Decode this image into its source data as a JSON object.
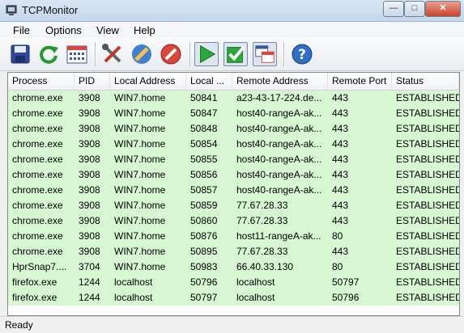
{
  "window": {
    "title": "TCPMonitor"
  },
  "menu": {
    "items": [
      "File",
      "Options",
      "View",
      "Help"
    ]
  },
  "toolbar": {
    "buttons": [
      "save-icon",
      "refresh-icon",
      "calendar-icon",
      "tools-icon",
      "edit-icon",
      "stop-icon",
      "play-icon",
      "checkbox-icon",
      "window-icon",
      "help-icon"
    ]
  },
  "table": {
    "columns": [
      "Process",
      "PID",
      "Local Address",
      "Local ...",
      "Remote Address",
      "Remote Port",
      "Status"
    ],
    "rows": [
      [
        "chrome.exe",
        "3908",
        "WIN7.home",
        "50841",
        "a23-43-17-224.de...",
        "443",
        "ESTABLISHED"
      ],
      [
        "chrome.exe",
        "3908",
        "WIN7.home",
        "50847",
        "host40-rangeA-ak...",
        "443",
        "ESTABLISHED"
      ],
      [
        "chrome.exe",
        "3908",
        "WIN7.home",
        "50848",
        "host40-rangeA-ak...",
        "443",
        "ESTABLISHED"
      ],
      [
        "chrome.exe",
        "3908",
        "WIN7.home",
        "50854",
        "host40-rangeA-ak...",
        "443",
        "ESTABLISHED"
      ],
      [
        "chrome.exe",
        "3908",
        "WIN7.home",
        "50855",
        "host40-rangeA-ak...",
        "443",
        "ESTABLISHED"
      ],
      [
        "chrome.exe",
        "3908",
        "WIN7.home",
        "50856",
        "host40-rangeA-ak...",
        "443",
        "ESTABLISHED"
      ],
      [
        "chrome.exe",
        "3908",
        "WIN7.home",
        "50857",
        "host40-rangeA-ak...",
        "443",
        "ESTABLISHED"
      ],
      [
        "chrome.exe",
        "3908",
        "WIN7.home",
        "50859",
        "77.67.28.33",
        "443",
        "ESTABLISHED"
      ],
      [
        "chrome.exe",
        "3908",
        "WIN7.home",
        "50860",
        "77.67.28.33",
        "443",
        "ESTABLISHED"
      ],
      [
        "chrome.exe",
        "3908",
        "WIN7.home",
        "50876",
        "host11-rangeA-ak...",
        "80",
        "ESTABLISHED"
      ],
      [
        "chrome.exe",
        "3908",
        "WIN7.home",
        "50895",
        "77.67.28.33",
        "443",
        "ESTABLISHED"
      ],
      [
        "HprSnap7....",
        "3704",
        "WIN7.home",
        "50983",
        "66.40.33.130",
        "80",
        "ESTABLISHED"
      ],
      [
        "firefox.exe",
        "1244",
        "localhost",
        "50796",
        "localhost",
        "50797",
        "ESTABLISHED"
      ],
      [
        "firefox.exe",
        "1244",
        "localhost",
        "50797",
        "localhost",
        "50796",
        "ESTABLISHED"
      ]
    ]
  },
  "colors": {
    "row_background": "#d7f7d3"
  },
  "status": {
    "text": "Ready"
  }
}
